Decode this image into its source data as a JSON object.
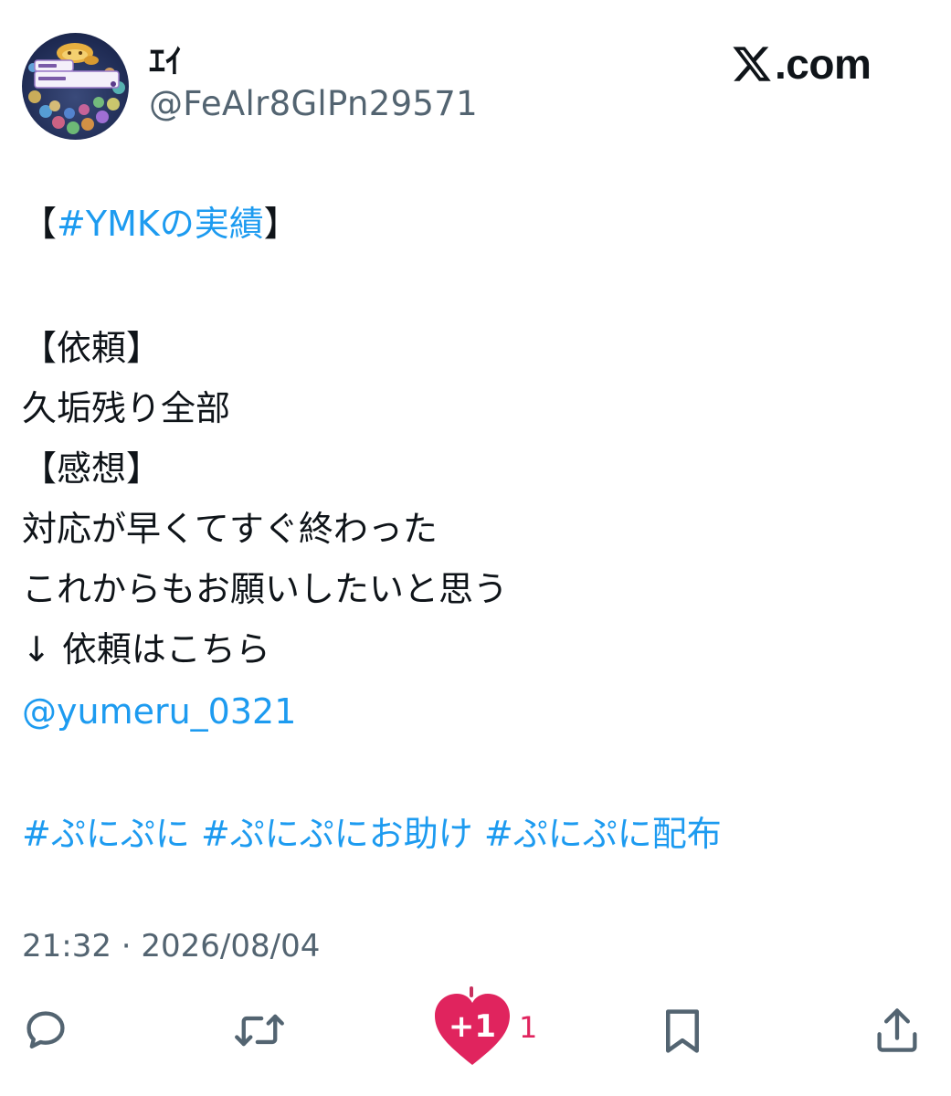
{
  "header": {
    "display_name": "ｴｲ",
    "handle": "@FeAlr8GlPn29571",
    "brand": "𝕏.com",
    "brand_text": ".com",
    "avatar_icon": "profile-avatar"
  },
  "tweet": {
    "line1_open": "【",
    "line1_tag": "#YMKの実績",
    "line1_close": "】",
    "line2": "【依頼】",
    "line3": "久垢残り全部",
    "line4": "【感想】",
    "line5": "対応が早くてすぐ終わった",
    "line6": "これからもお願いしたいと思う",
    "line7": "↓ 依頼はこちら",
    "mention": "@yumeru_0321",
    "hashtag1": "#ぷにぷに",
    "hashtag2": "#ぷにぷにお助け",
    "hashtag3": "#ぷにぷに配布"
  },
  "timestamp": "21:32 · 2026/08/04",
  "actions": {
    "reply_icon": "reply-icon",
    "retweet_icon": "retweet-icon",
    "like_icon": "heart-plus-one-icon",
    "like_badge": "+1",
    "like_count": "1",
    "bookmark_icon": "bookmark-icon",
    "share_icon": "share-icon"
  },
  "colors": {
    "link": "#1d9bf0",
    "muted": "#536471",
    "text": "#0f1419",
    "like": "#e0245e"
  }
}
